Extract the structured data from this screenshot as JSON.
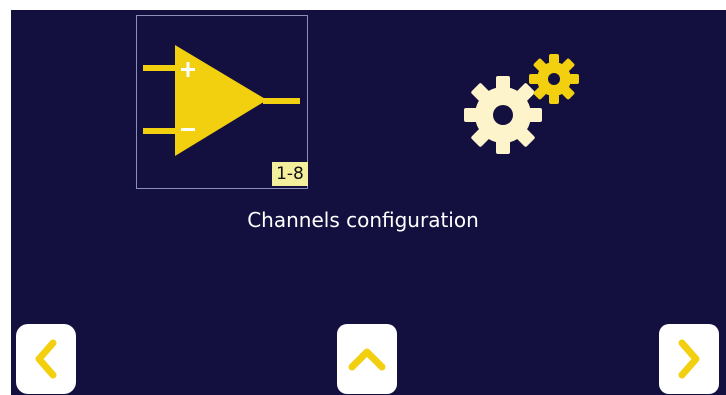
{
  "tiles": {
    "amplifier": {
      "icon": "op-amp-icon",
      "range_label": "1-8"
    },
    "settings": {
      "icon": "gears-icon"
    }
  },
  "caption": "Channels configuration",
  "nav": {
    "left": {
      "icon": "chevron-left-icon"
    },
    "up": {
      "icon": "chevron-up-icon"
    },
    "right": {
      "icon": "chevron-right-icon"
    }
  },
  "colors": {
    "background": "#13103f",
    "accent": "#f2cf0f",
    "badge": "#f4ef9c"
  }
}
